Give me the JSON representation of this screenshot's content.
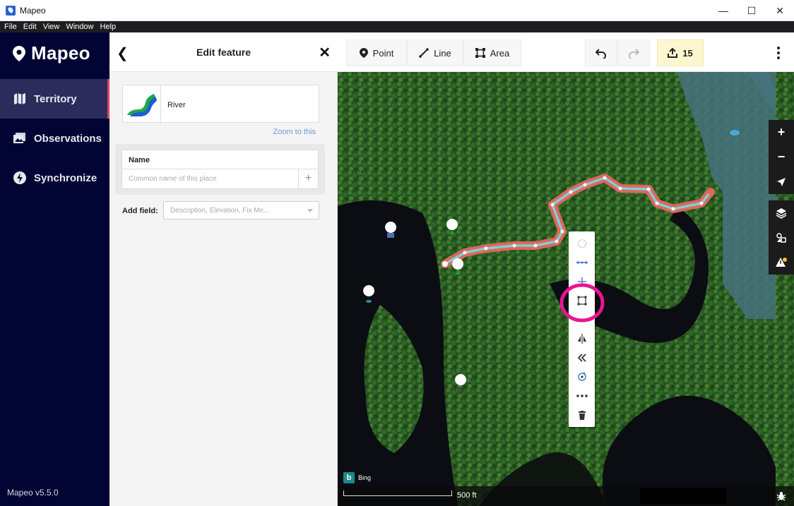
{
  "window": {
    "title": "Mapeo",
    "controls": [
      "—",
      "☐",
      "✕"
    ]
  },
  "menubar": [
    "File",
    "Edit",
    "View",
    "Window",
    "Help"
  ],
  "sidebar": {
    "brand": "Mapeo",
    "items": [
      {
        "label": "Territory",
        "icon": "map-icon",
        "active": true
      },
      {
        "label": "Observations",
        "icon": "photo-icon",
        "active": false
      },
      {
        "label": "Synchronize",
        "icon": "lightning-icon",
        "active": false
      }
    ],
    "version": "Mapeo v5.5.0"
  },
  "panel": {
    "title": "Edit feature",
    "back_icon": "chevron-left-icon",
    "close_icon": "close-icon",
    "preset": {
      "name": "River",
      "icon": "river-icon"
    },
    "zoom_link": "Zoom to this",
    "name_field": {
      "label": "Name",
      "value": "",
      "placeholder": "Common name of this place"
    },
    "add_field": {
      "label": "Add field:",
      "placeholder": "Description, Elevation, Fix Me..."
    }
  },
  "toolbar": {
    "point_label": "Point",
    "line_label": "Line",
    "area_label": "Area",
    "undo_icon": "undo-icon",
    "redo_icon": "redo-icon",
    "share_count": "15",
    "more_icon": "kebab-icon"
  },
  "map": {
    "attribution": "Bing",
    "scale_label": "500 ft",
    "edit_menu": [
      "circularize-icon",
      "straighten-icon",
      "move-icon",
      "square-icon",
      "reflect-icon",
      "reverse-icon",
      "rotate-icon",
      "split-icon",
      "delete-icon"
    ],
    "highlighted_tool": "square-icon",
    "colors": {
      "selected_line": "#e0665b",
      "river_line": "#7ecfd8",
      "highlight_ring": "#e8158f"
    }
  }
}
